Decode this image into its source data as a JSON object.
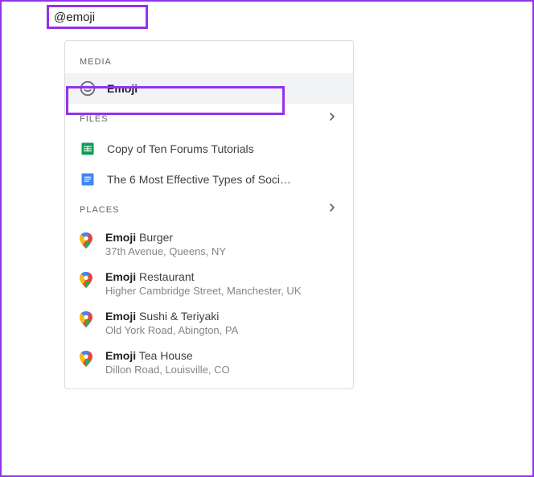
{
  "input": {
    "text": "@emoji"
  },
  "sections": {
    "media": {
      "label": "MEDIA",
      "items": [
        {
          "label": "Emoji",
          "bold": "Emoji",
          "rest": ""
        }
      ]
    },
    "files": {
      "label": "FILES",
      "items": [
        {
          "label": "Copy of Ten Forums Tutorials",
          "type": "sheets"
        },
        {
          "label": "The 6 Most Effective Types of Soci…",
          "type": "docs"
        }
      ]
    },
    "places": {
      "label": "PLACES",
      "items": [
        {
          "bold": "Emoji",
          "rest": " Burger",
          "address": "37th Avenue, Queens, NY"
        },
        {
          "bold": "Emoji",
          "rest": " Restaurant",
          "address": "Higher Cambridge Street, Manchester, UK"
        },
        {
          "bold": "Emoji",
          "rest": " Sushi & Teriyaki",
          "address": "Old York Road, Abington, PA"
        },
        {
          "bold": "Emoji",
          "rest": " Tea House",
          "address": "Dillon Road, Louisville, CO"
        }
      ]
    }
  }
}
